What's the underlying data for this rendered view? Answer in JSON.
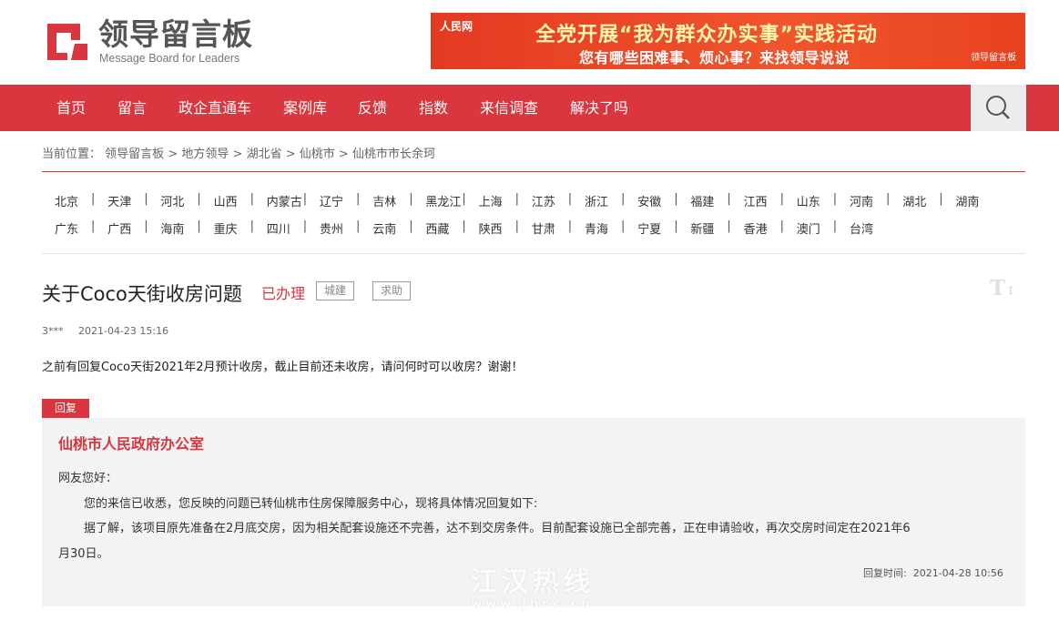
{
  "brand": {
    "name_cn": "领导留言板",
    "name_en": "Message Board for Leaders"
  },
  "banner": {
    "brand": "人民网",
    "line1": "全党开展“我为群众办实事”实践活动",
    "line2": "您有哪些困难事、烦心事？来找领导说说",
    "logo": "领导留言板"
  },
  "nav": {
    "items": [
      "首页",
      "留言",
      "政企直通车",
      "案例库",
      "反馈",
      "指数",
      "来信调查",
      "解决了吗"
    ],
    "search_icon": "search-icon"
  },
  "breadcrumb": {
    "prefix": "当前位置：",
    "items": [
      "领导留言板",
      "地方领导",
      "湖北省",
      "仙桃市",
      "仙桃市市长余珂"
    ],
    "separator": ">"
  },
  "provinces": {
    "row1": [
      "北京",
      "天津",
      "河北",
      "山西",
      "内蒙古",
      "辽宁",
      "吉林",
      "黑龙江",
      "上海",
      "江苏",
      "浙江",
      "安徽",
      "福建",
      "江西",
      "山东",
      "河南",
      "湖北",
      "湖南"
    ],
    "row2": [
      "广东",
      "广西",
      "海南",
      "重庆",
      "四川",
      "贵州",
      "云南",
      "西藏",
      "陕西",
      "甘肃",
      "青海",
      "宁夏",
      "新疆",
      "香港",
      "澳门",
      "台湾"
    ],
    "separator": "|"
  },
  "message": {
    "title": "关于Coco天街收房问题",
    "status": "已办理",
    "tags": [
      "城建",
      "求助"
    ],
    "font_toggle": "T",
    "user": "3***",
    "time": "2021-04-23 15:16",
    "content": "之前有回复Coco天街2021年2月预计收房，截止目前还未收房，请问何时可以收房？谢谢！"
  },
  "reply": {
    "tab_label": "回复",
    "org": "仙桃市人民政府办公室",
    "greeting": "网友您好：",
    "para1": "您的来信已收悉，您反映的问题已转仙桃市住房保障服务中心，现将具体情况回复如下:",
    "para2a": "据了解，该项目原先准备在2月底交房，因为相关配套设施还不完善，达不到交房条件。目前配套设施已全部完善，正在申请验收，再次交房时间定在2021年6",
    "para2b": "月30日。",
    "time_label": "回复时间:",
    "time": "2021-04-28 10:56"
  },
  "watermark": {
    "line1": "江汉热线",
    "line2": "www.jhrx.cn"
  },
  "colors": {
    "accent": "#d9363f",
    "reply_bg": "#f2f3f5"
  }
}
